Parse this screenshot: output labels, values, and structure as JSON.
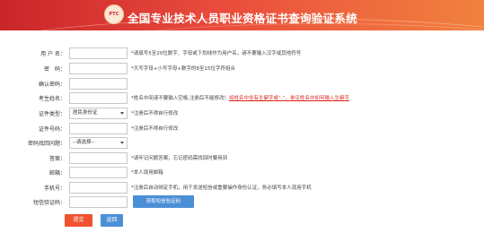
{
  "header": {
    "logo_text": "PTC",
    "title": "全国专业技术人员职业资格证书查询验证系统"
  },
  "form": {
    "username": {
      "label": "用 户 名：",
      "hint": "*请填写5至20位数字、字母或下划线作为用户名，请不要输入汉字或其他符号"
    },
    "password": {
      "label": "密　码：",
      "hint": "*大写字母+小写字母+数字的8至15位字符组合"
    },
    "confirm_password": {
      "label": "确认密码："
    },
    "name": {
      "label": "考生姓名：",
      "hint_prefix": "*姓名中间请不要输入空格,注册后不能修改！",
      "hint_link1": "如姓名中含有生僻字或“·”",
      "hint_link2": "，参见姓名中如何输入生僻字"
    },
    "id_type": {
      "label": "证件类型：",
      "value": "居民身份证",
      "hint": "*注册后不得自行修改"
    },
    "id_number": {
      "label": "证件号码：",
      "hint": "*注册后不得自行修改"
    },
    "security_question": {
      "label": "密码找回问题：",
      "value": "--请选择--"
    },
    "answer": {
      "label": "答案：",
      "hint": "*请牢记问题答案，忘记密码需找回时要用到"
    },
    "email": {
      "label": "邮箱：",
      "hint": "*本人现用邮箱"
    },
    "phone": {
      "label": "手机号：",
      "hint": "*注册后自动绑定手机，用于发送短信或重要操作身份认证，务必填写本人现用手机"
    },
    "sms_code": {
      "label": "短信验证码：",
      "button": "获取短信验证码"
    }
  },
  "actions": {
    "submit": "提交",
    "back": "返回"
  },
  "colors": {
    "header_red": "#c9262a",
    "header_orange": "#f0813f",
    "submit_orange": "#f0522e",
    "button_blue": "#4b8fd6",
    "hint_red": "#d9261c"
  }
}
